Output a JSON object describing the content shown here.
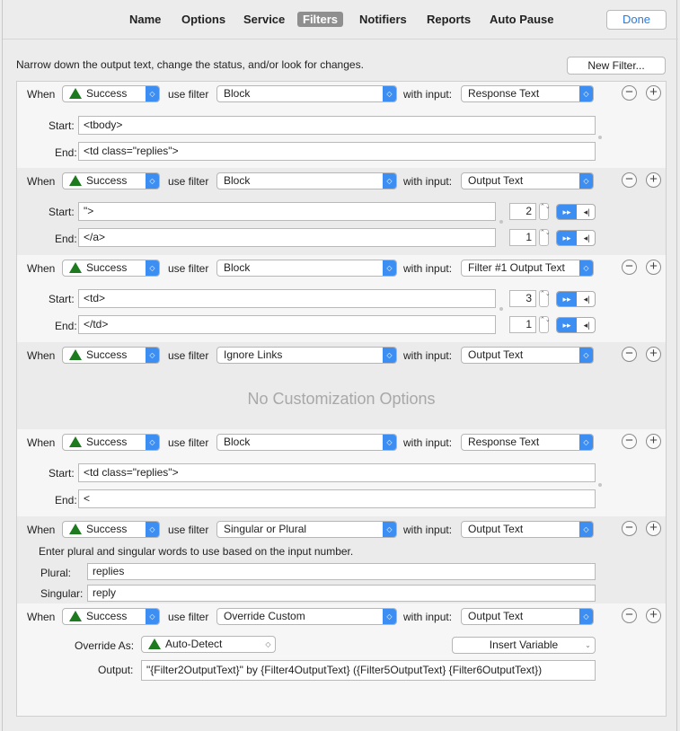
{
  "toolbar": {
    "tabs": [
      "Name",
      "Options",
      "Service",
      "Filters",
      "Notifiers",
      "Reports",
      "Auto Pause"
    ],
    "active_tab": "Filters",
    "done_label": "Done"
  },
  "description": "Narrow down the output text, change the status, and/or look for changes.",
  "new_filter_label": "New Filter...",
  "labels": {
    "when": "When",
    "use_filter": "use filter",
    "with_input": "with input:",
    "start": "Start:",
    "end": "End:",
    "plural": "Plural:",
    "singular": "Singular:",
    "override_as": "Override As:",
    "output": "Output:",
    "no_custom": "No Customization Options",
    "plural_hint": "Enter plural and singular words to use based on the input number."
  },
  "filters": [
    {
      "status": "Success",
      "filter": "Block",
      "input": "Response Text",
      "start": "<tbody>",
      "end": "<td class=\"replies\">"
    },
    {
      "status": "Success",
      "filter": "Block",
      "input": "Output Text",
      "start": "\">",
      "end": "</a>",
      "start_count": "2",
      "end_count": "1"
    },
    {
      "status": "Success",
      "filter": "Block",
      "input": "Filter #1 Output Text",
      "start": "<td>",
      "end": "</td>",
      "start_count": "3",
      "end_count": "1"
    },
    {
      "status": "Success",
      "filter": "Ignore Links",
      "input": "Output Text"
    },
    {
      "status": "Success",
      "filter": "Block",
      "input": "Response Text",
      "start": "<td class=\"replies\">",
      "end": "<"
    },
    {
      "status": "Success",
      "filter": "Singular or Plural",
      "input": "Output Text",
      "plural": "replies",
      "singular": "reply"
    },
    {
      "status": "Success",
      "filter": "Override Custom",
      "input": "Output Text",
      "override_as": "Auto-Detect",
      "insert_variable": "Insert Variable",
      "output": "\"{Filter2OutputText}\" by {Filter4OutputText} ({Filter5OutputText} {Filter6OutputText})"
    }
  ],
  "icons": {
    "minus": "−",
    "plus": "+",
    "popup_arrow": "◇",
    "stepper": "⌃⌄"
  },
  "colors": {
    "accent": "#3d8ef2",
    "success": "#1e7a1e",
    "done_text": "#2a7ae2"
  }
}
